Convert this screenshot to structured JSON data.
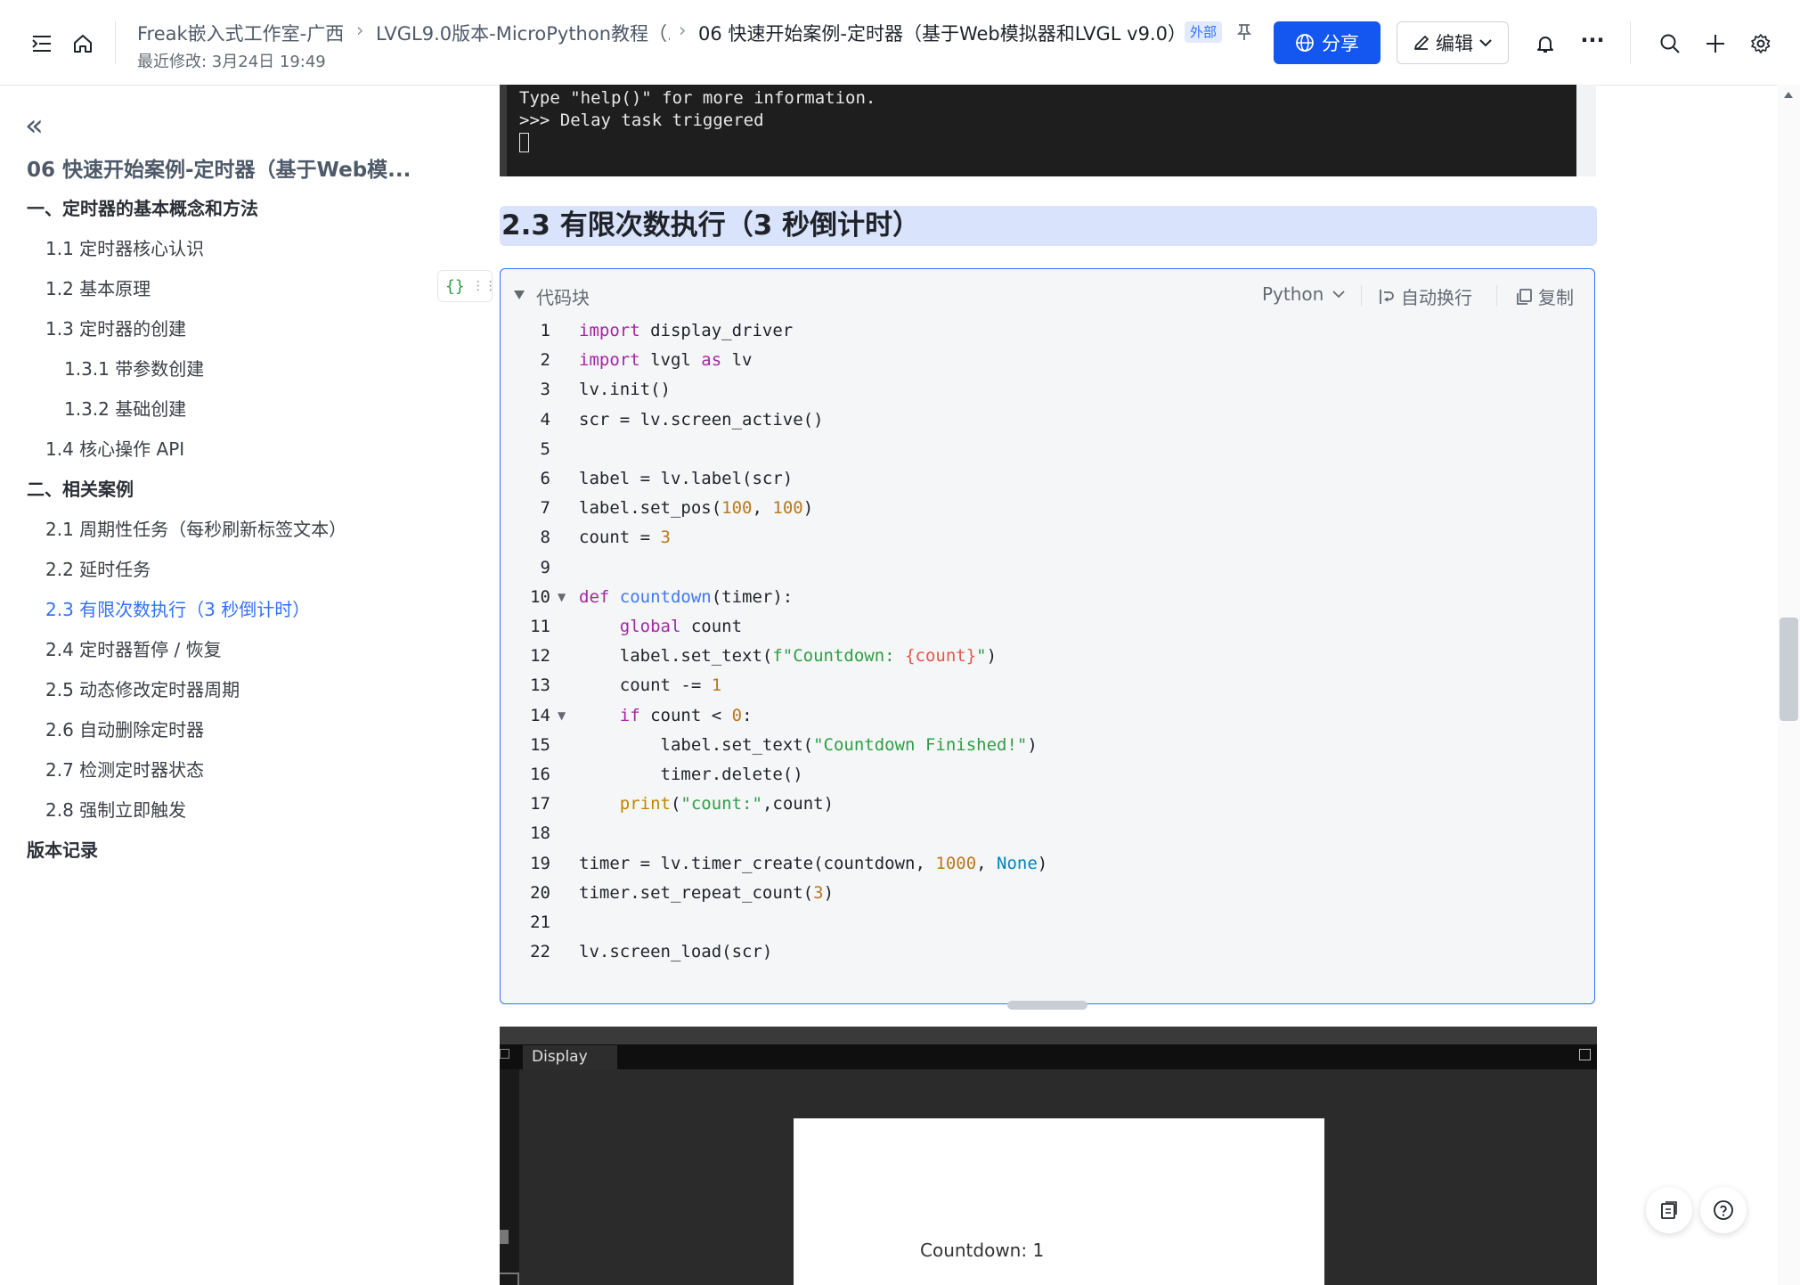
{
  "header": {
    "breadcrumbs": [
      "Freak嵌入式工作室-广西",
      "LVGL9.0版本-MicroPython教程（...",
      "06 快速开始案例-定时器（基于Web模拟器和LVGL v9.0）"
    ],
    "modified": "最近修改: 3月24日 19:49",
    "external_badge": "外部",
    "share_label": "分享",
    "edit_label": "编辑",
    "more": "···"
  },
  "sidebar": {
    "collapse_icon": "«",
    "doc_title": "06 快速开始案例-定时器（基于Web模...",
    "items": [
      {
        "label": "一、定时器的基本概念和方法",
        "level": 0
      },
      {
        "label": "1.1 定时器核心认识",
        "level": 1
      },
      {
        "label": "1.2 基本原理",
        "level": 1
      },
      {
        "label": "1.3 定时器的创建",
        "level": 1
      },
      {
        "label": "1.3.1 带参数创建",
        "level": 2
      },
      {
        "label": "1.3.2 基础创建",
        "level": 2
      },
      {
        "label": "1.4 核心操作 API",
        "level": 1
      },
      {
        "label": "二、相关案例",
        "level": 0
      },
      {
        "label": "2.1 周期性任务（每秒刷新标签文本）",
        "level": 1
      },
      {
        "label": "2.2 延时任务",
        "level": 1
      },
      {
        "label": "2.3 有限次数执行（3 秒倒计时）",
        "level": 1,
        "active": true
      },
      {
        "label": "2.4 定时器暂停 / 恢复",
        "level": 1
      },
      {
        "label": "2.5 动态修改定时器周期",
        "level": 1
      },
      {
        "label": "2.6 自动删除定时器",
        "level": 1
      },
      {
        "label": "2.7 检测定时器状态",
        "level": 1
      },
      {
        "label": "2.8 强制立即触发",
        "level": 1
      },
      {
        "label": "版本记录",
        "level": 0
      }
    ],
    "block_tool": "{}"
  },
  "terminal": {
    "lines": [
      "Type \"help()\" for more information.",
      ">>> Delay task triggered"
    ]
  },
  "section": {
    "heading": "2.3 有限次数执行（3 秒倒计时）"
  },
  "codeblock": {
    "title": "代码块",
    "language": "Python",
    "wrap_label": "自动换行",
    "copy_label": "复制",
    "line_numbers": [
      "1",
      "2",
      "3",
      "4",
      "5",
      "6",
      "7",
      "8",
      "9",
      "10",
      "11",
      "12",
      "13",
      "14",
      "15",
      "16",
      "17",
      "18",
      "19",
      "20",
      "21",
      "22"
    ],
    "lines": [
      "import display_driver",
      "import lvgl as lv",
      "lv.init()",
      "scr = lv.screen_active()",
      "",
      "label = lv.label(scr)",
      "label.set_pos(100, 100)",
      "count = 3",
      "",
      "def countdown(timer):",
      "    global count",
      "    label.set_text(f\"Countdown: {count}\")",
      "    count -= 1",
      "    if count < 0:",
      "        label.set_text(\"Countdown Finished!\")",
      "        timer.delete()",
      "    print(\"count:\",count)",
      "",
      "timer = lv.timer_create(countdown, 1000, None)",
      "timer.set_repeat_count(3)",
      "",
      "lv.screen_load(scr)"
    ]
  },
  "simulator": {
    "tab_label": "Display",
    "screen_label": "Countdown: 1"
  },
  "colors": {
    "accent": "#3370ff",
    "share_button": "#1456f0",
    "heading_bg": "#d9e3fb",
    "terminal_bg": "#1e1e1e"
  }
}
